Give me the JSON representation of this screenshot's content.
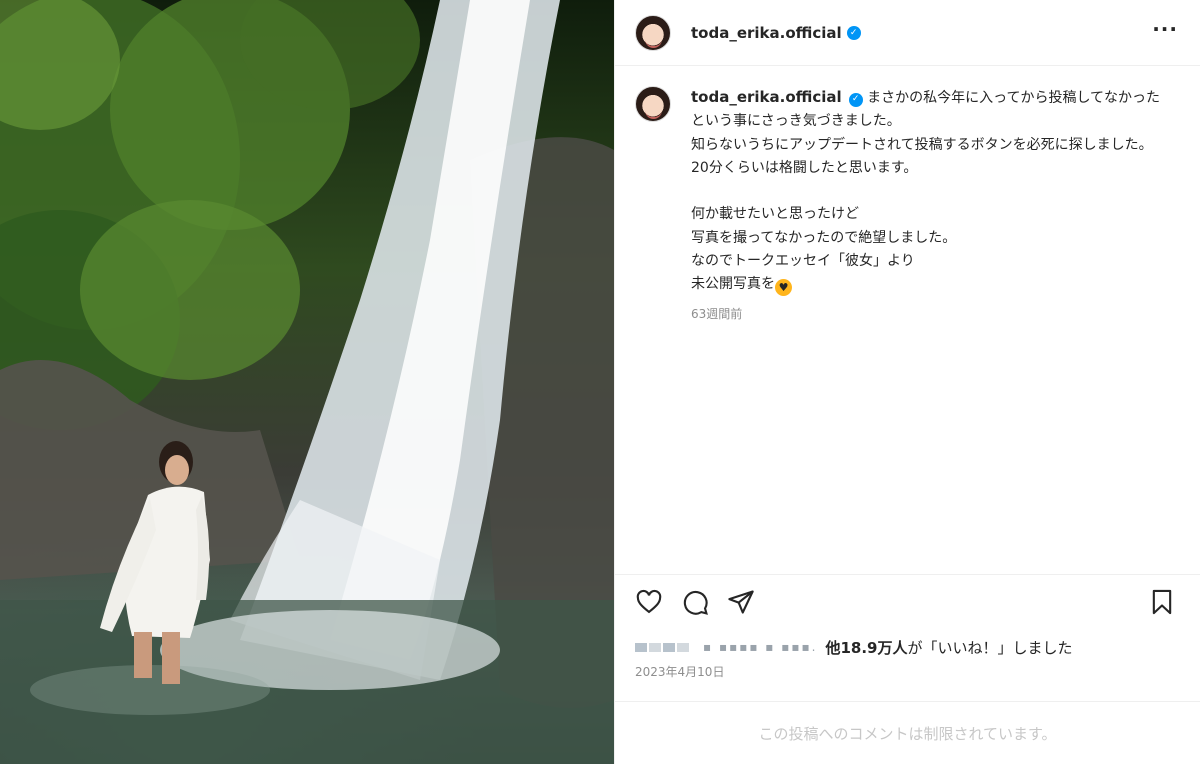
{
  "post": {
    "username": "toda_erika.official",
    "verified": true,
    "more_icon": "ellipsis-icon",
    "caption": "まさかの私今年に入ってから投稿してなかったという事にさっき気づきました。\n知らないうちにアップデートされて投稿するボタンを必死に探しました。\n20分くらいは格闘したと思います。\n\n何か載せたいと思ったけど\n写真を撮ってなかったので絶望しました。\nなのでトークエッセイ「彼女」より\n未公開写真を",
    "caption_emoji": "🥰",
    "posted_ago": "63週間前",
    "actions": {
      "like_icon": "heart-icon",
      "comment_icon": "comment-icon",
      "share_icon": "send-icon",
      "save_icon": "bookmark-icon"
    },
    "likes_prefix": "他",
    "likes_count": "18.9万人",
    "likes_suffix": "が「いいね！」しました",
    "date": "2023年4月10日",
    "comments_restricted": "この投稿へのコメントは制限されています。"
  },
  "colors": {
    "verified_blue": "#0095f6",
    "text": "#262626",
    "secondary": "#8e8e8e",
    "border": "#efefef"
  }
}
